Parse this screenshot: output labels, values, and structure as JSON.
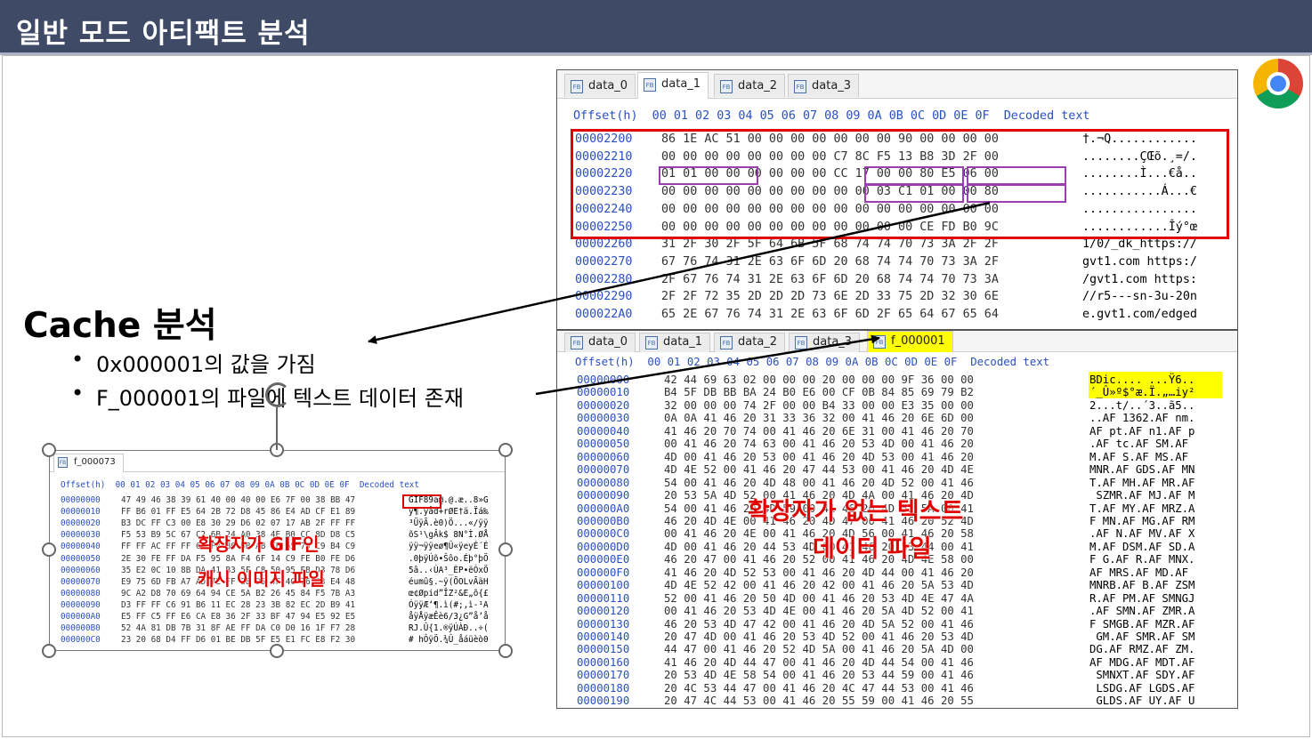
{
  "slide": {
    "title": "일반 모드 아티팩트 분석"
  },
  "left": {
    "heading": "Cache 분석",
    "bullets": [
      "0x000001의 값을 가짐",
      "F_000001의 파일에 텍스트 데이터 존재"
    ]
  },
  "hex1": {
    "tabs": [
      "data_0",
      "data_1",
      "data_2",
      "data_3"
    ],
    "header": "Offset(h)  00 01 02 03 04 05 06 07 08 09 0A 0B 0C 0D 0E 0F  Decoded text",
    "rows": [
      {
        "off": "00002200",
        "hex": "86 1E AC 51 00 00 00 00 00 00 00 90 00 00 00 00",
        "dec": "†.¬Q............"
      },
      {
        "off": "00002210",
        "hex": "00 00 00 00 00 00 00 00 C7 8C F5 13 B8 3D 2F 00",
        "dec": "........ÇŒõ.¸=/."
      },
      {
        "off": "00002220",
        "hex": "01 01 00 00 00 00 00 00 CC 17 00 00 80 E5 06 00",
        "dec": "........Ì...€å.."
      },
      {
        "off": "00002230",
        "hex": "00 00 00 00 00 00 00 00 00 00 03 C1 01 00 00 80",
        "dec": "...........Á...€"
      },
      {
        "off": "00002240",
        "hex": "00 00 00 00 00 00 00 00 00 00 00 00 00 00 00 00",
        "dec": "................"
      },
      {
        "off": "00002250",
        "hex": "00 00 00 00 00 00 00 00 00 00 00 00 CE FD B0 9C",
        "dec": "............Îý°œ"
      },
      {
        "off": "00002260",
        "hex": "31 2F 30 2F 5F 64 6B 5F 68 74 74 70 73 3A 2F 2F",
        "dec": "1/0/_dk_https://"
      },
      {
        "off": "00002270",
        "hex": "67 76 74 31 2E 63 6F 6D 20 68 74 74 70 73 3A 2F",
        "dec": "gvt1.com https:/"
      },
      {
        "off": "00002280",
        "hex": "2F 67 76 74 31 2E 63 6F 6D 20 68 74 74 70 73 3A",
        "dec": "/gvt1.com https:"
      },
      {
        "off": "00002290",
        "hex": "2F 2F 72 35 2D 2D 2D 73 6E 2D 33 75 2D 32 30 6E",
        "dec": "//r5---sn-3u-20n"
      },
      {
        "off": "000022A0",
        "hex": "65 2E 67 76 74 31 2E 63 6F 6D 2F 65 64 67 65 64",
        "dec": "e.gvt1.com/edged"
      }
    ]
  },
  "hex2": {
    "tabs": [
      "data_0",
      "data_1",
      "data_2",
      "data_3",
      "f_000001"
    ],
    "header": "Offset(h)  00 01 02 03 04 05 06 07 08 09 0A 0B 0C 0D 0E 0F  Decoded text",
    "rows": [
      {
        "off": "00000000",
        "hex": "42 44 69 63 02 00 00 00 20 00 00 00 9F 36 00 00",
        "dec": "BDic.... ...Ÿ6.."
      },
      {
        "off": "00000010",
        "hex": "B4 5F DB BB BA 24 B0 E6 00 CF 0B 84 85 69 79 B2",
        "dec": "´_Û»º$°æ.Ï.„…iy²"
      },
      {
        "off": "00000020",
        "hex": "32 00 00 00 74 2F 00 00 B4 33 00 00 E3 35 00 00",
        "dec": "2...t/..´3..ã5.."
      },
      {
        "off": "00000030",
        "hex": "0A 0A 41 46 20 31 33 36 32 00 41 46 20 6E 6D 00",
        "dec": "..AF 1362.AF nm."
      },
      {
        "off": "00000040",
        "hex": "41 46 20 70 74 00 41 46 20 6E 31 00 41 46 20 70",
        "dec": "AF pt.AF n1.AF p"
      },
      {
        "off": "00000050",
        "hex": "00 41 46 20 74 63 00 41 46 20 53 4D 00 41 46 20",
        "dec": ".AF tc.AF SM.AF "
      },
      {
        "off": "00000060",
        "hex": "4D 00 41 46 20 53 00 41 46 20 4D 53 00 41 46 20",
        "dec": "M.AF S.AF MS.AF "
      },
      {
        "off": "00000070",
        "hex": "4D 4E 52 00 41 46 20 47 44 53 00 41 46 20 4D 4E",
        "dec": "MNR.AF GDS.AF MN"
      },
      {
        "off": "00000080",
        "hex": "54 00 41 46 20 4D 48 00 41 46 20 4D 52 00 41 46",
        "dec": "T.AF MH.AF MR.AF"
      },
      {
        "off": "00000090",
        "hex": "20 53 5A 4D 52 00 41 46 20 4D 4A 00 41 46 20 4D",
        "dec": " SZMR.AF MJ.AF M"
      },
      {
        "off": "000000A0",
        "hex": "54 00 41 46 20 4D 59 00 41 46 20 4D 52 5A 00 41",
        "dec": "T.AF MY.AF MRZ.A"
      },
      {
        "off": "000000B0",
        "hex": "46 20 4D 4E 00 41 46 20 4D 47 00 41 46 20 52 4D",
        "dec": "F MN.AF MG.AF RM"
      },
      {
        "off": "000000C0",
        "hex": "00 41 46 20 4E 00 41 46 20 4D 56 00 41 46 20 58",
        "dec": ".AF N.AF MV.AF X"
      },
      {
        "off": "000000D0",
        "hex": "4D 00 41 46 20 44 53 4D 00 41 46 20 53 44 00 41",
        "dec": "M.AF DSM.AF SD.A"
      },
      {
        "off": "000000E0",
        "hex": "46 20 47 00 41 46 20 52 00 41 46 20 4D 4E 58 00",
        "dec": "F G.AF R.AF MNX."
      },
      {
        "off": "000000F0",
        "hex": "41 46 20 4D 52 53 00 41 46 20 4D 44 00 41 46 20",
        "dec": "AF MRS.AF MD.AF "
      },
      {
        "off": "00000100",
        "hex": "4D 4E 52 42 00 41 46 20 42 00 41 46 20 5A 53 4D",
        "dec": "MNRB.AF B.AF ZSM"
      },
      {
        "off": "00000110",
        "hex": "52 00 41 46 20 50 4D 00 41 46 20 53 4D 4E 47 4A",
        "dec": "R.AF PM.AF SMNGJ"
      },
      {
        "off": "00000120",
        "hex": "00 41 46 20 53 4D 4E 00 41 46 20 5A 4D 52 00 41",
        "dec": ".AF SMN.AF ZMR.A"
      },
      {
        "off": "00000130",
        "hex": "46 20 53 4D 47 42 00 41 46 20 4D 5A 52 00 41 46",
        "dec": "F SMGB.AF MZR.AF"
      },
      {
        "off": "00000140",
        "hex": "20 47 4D 00 41 46 20 53 4D 52 00 41 46 20 53 4D",
        "dec": " GM.AF SMR.AF SM"
      },
      {
        "off": "00000150",
        "hex": "44 47 00 41 46 20 52 4D 5A 00 41 46 20 5A 4D 00",
        "dec": "DG.AF RMZ.AF ZM."
      },
      {
        "off": "00000160",
        "hex": "41 46 20 4D 44 47 00 41 46 20 4D 44 54 00 41 46",
        "dec": "AF MDG.AF MDT.AF"
      },
      {
        "off": "00000170",
        "hex": "20 53 4D 4E 58 54 00 41 46 20 53 44 59 00 41 46",
        "dec": " SMNXT.AF SDY.AF"
      },
      {
        "off": "00000180",
        "hex": "20 4C 53 44 47 00 41 46 20 4C 47 44 53 00 41 46",
        "dec": " LSDG.AF LGDS.AF"
      },
      {
        "off": "00000190",
        "hex": "20 47 4C 44 53 00 41 46 20 55 59 00 41 46 20 55",
        "dec": " GLDS.AF UY.AF U"
      }
    ]
  },
  "hex3": {
    "tab": "f_000073",
    "header": "Offset(h)  00 01 02 03 04 05 06 07 08 09 0A 0B 0C 0D 0E 0F  Decoded text",
    "rows": [
      {
        "off": "00000000",
        "hex": "47 49 46 38 39 61 40 00 40 00 E6 7F 00 38 BB 47",
        "dec": "GIF89a@.@.æ..8»G"
      },
      {
        "off": "00000010",
        "hex": "FF B6 01 FF E5 64 2B 72 D8 45 86 E4 AD CF E1 89",
        "dec": "ÿ¶.ÿåd+rØE†ä.Ïá‰"
      },
      {
        "off": "00000020",
        "hex": "B3 DC FF C3 00 E8 30 29 D6 02 07 17 AB 2F FF FF",
        "dec": "³ÜÿÃ.è0)Ö...«/ÿÿ"
      },
      {
        "off": "00000030",
        "hex": "F5 53 B9 5C 67 C2 6B 24 A0 38 4E B0 CC 8D D8 C5",
        "dec": "õS¹\\gÂk$ 8N°Ì.ØÅ"
      },
      {
        "off": "00000040",
        "hex": "FF FF AC FF FF 65 F8 B6 DB AB FF 65 79 C9 B4 C9",
        "dec": "ÿÿ¬ÿÿeø¶Û«ÿeyÉ´É"
      },
      {
        "off": "00000050",
        "hex": "2E 30 FE FF DA F5 95 8A F4 6F 14 C9 FE B0 FE D6",
        "dec": ".0þÿÚõ•Šôo.Éþ°þÖ"
      },
      {
        "off": "00000060",
        "hex": "35 E2 0C 10 8B DA 41 B3 5F C8 50 95 EB D3 78 D6",
        "dec": "5â..‹ÚA³_ÈP•ëÓxÖ"
      },
      {
        "off": "00000070",
        "hex": "E9 75 6D FB A7 AD 7E FF 28 D5 4F 4C 76 C3 E4 48",
        "dec": "éumû§.~ÿ(ÕOLvÃäH"
      },
      {
        "off": "00000080",
        "hex": "9C A2 D8 70 69 64 94 CE 5A B2 26 45 84 F5 7B A3",
        "dec": "œ¢Øpid”ÎZ²&E„õ{£"
      },
      {
        "off": "00000090",
        "hex": "D3 FF FF C6 91 B6 11 EC 28 23 3B 82 EC 2D B9 41",
        "dec": "ÓÿÿÆ‘¶.ì(#;‚ì-¹A"
      },
      {
        "off": "000000A0",
        "hex": "E5 FF C5 FF E6 CA E8 36 2F 33 BF 47 94 E5 92 E5",
        "dec": "åÿÅÿæÊè6/3¿G”å’å"
      },
      {
        "off": "000000B0",
        "hex": "52 4A 81 DB 7B 31 8F AE FF DA C0 D0 16 1F F7 28",
        "dec": "RJ.Û{1.®ÿÚÀÐ..÷("
      },
      {
        "off": "000000C0",
        "hex": "23 20 68 D4 FF D6 01 BE DB 5F E5 E1 FC E8 F2 30",
        "dec": "# hÔÿÖ.¾Û_åáüèò0"
      }
    ]
  },
  "annotations": {
    "gif_label_1": "확장자가 GIF인",
    "gif_label_2": "캐시 이미지 파일",
    "text_label_1": "확장자가 없는 텍스트",
    "text_label_2": "데이터 파일"
  },
  "colors": {
    "title_bg": "#3e4a66",
    "red": "#e00000",
    "purple": "#9b3fb0",
    "highlight": "#ffff00"
  }
}
